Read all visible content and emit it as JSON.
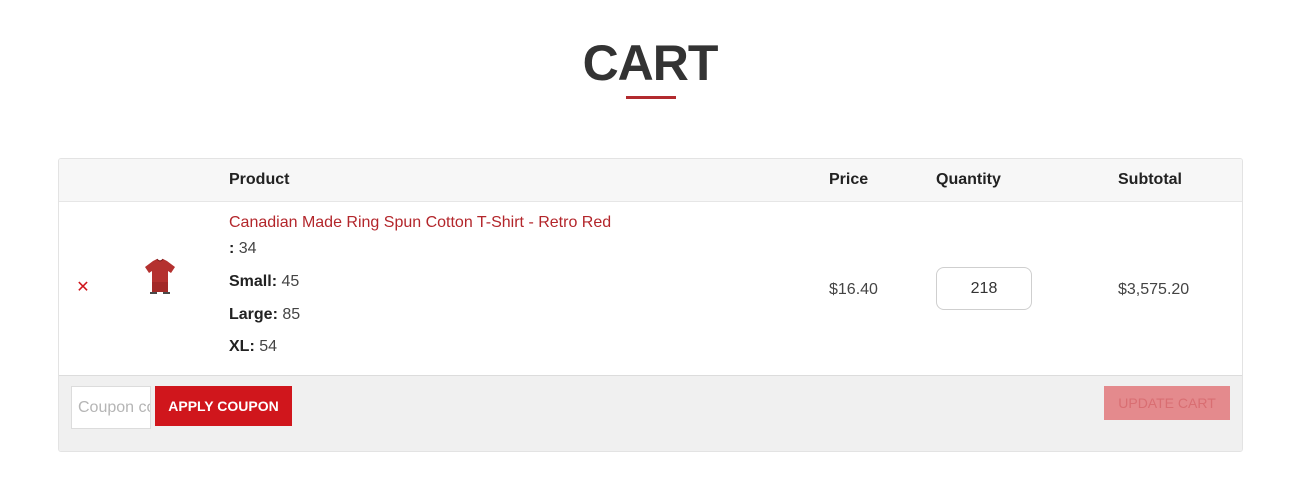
{
  "page": {
    "title": "CART",
    "accent_color": "#b22a2e"
  },
  "table": {
    "headers": {
      "product": "Product",
      "price": "Price",
      "quantity": "Quantity",
      "subtotal": "Subtotal"
    },
    "row": {
      "remove_icon": "close-icon",
      "remove_glyph": "✕",
      "product_name": "Canadian Made Ring Spun Cotton T-Shirt - Retro Red",
      "meta": [
        {
          "label": ":",
          "value": "34"
        },
        {
          "label": "Small:",
          "value": "45"
        },
        {
          "label": "Large:",
          "value": "85"
        },
        {
          "label": "XL:",
          "value": "54"
        }
      ],
      "price": "$16.40",
      "quantity": "218",
      "subtotal": "$3,575.20"
    }
  },
  "actions": {
    "coupon_placeholder": "Coupon code",
    "apply_label": "APPLY COUPON",
    "update_label": "UPDATE CART",
    "apply_color": "#d0161c",
    "update_color": "#e48a8d"
  }
}
